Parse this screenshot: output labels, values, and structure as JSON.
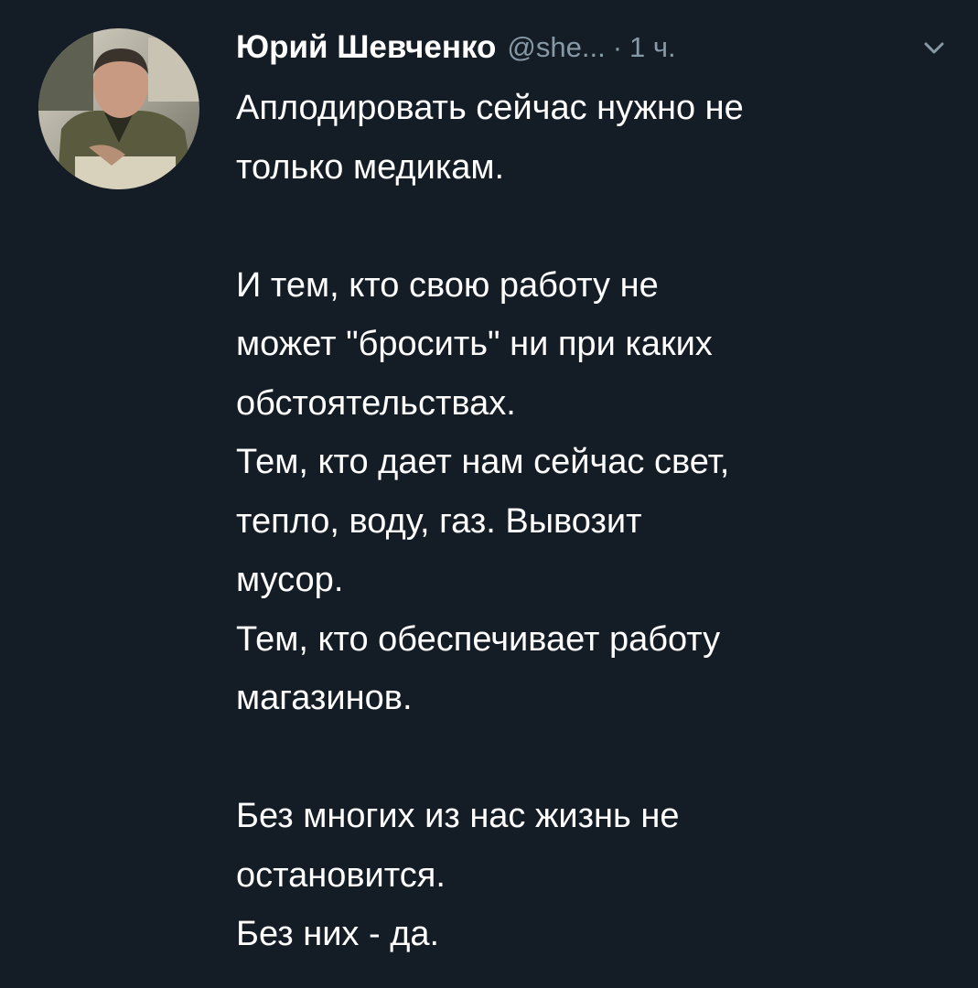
{
  "tweet": {
    "author": {
      "name": "Юрий Шевченко",
      "handle": "@she...",
      "avatar_icon": "user-avatar-photo"
    },
    "meta": {
      "separator": "·",
      "time": "1 ч."
    },
    "menu_icon": "chevron-down-icon",
    "colors": {
      "background": "#141d26",
      "text": "#ffffff",
      "secondary_text": "#8899a6"
    },
    "lines": [
      "Аплодировать сейчас нужно не",
      "только медикам.",
      "",
      "И тем, кто свою работу не",
      "может \"бросить\" ни при каких",
      "обстоятельствах.",
      "Тем, кто дает нам сейчас свет,",
      "тепло, воду, газ. Вывозит",
      "мусор.",
      "Тем, кто обеспечивает работу",
      "магазинов.",
      "",
      "Без многих из нас жизнь не",
      "остановится.",
      "Без них - да."
    ]
  }
}
